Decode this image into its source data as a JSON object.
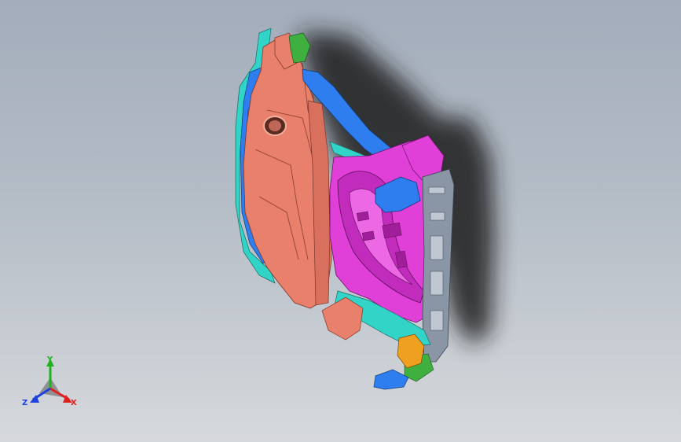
{
  "viewport": {
    "background_top": "#a3adbb",
    "background_bottom": "#d6d9dc"
  },
  "model": {
    "colors": {
      "salmon_panel": "#e8806b",
      "magenta_panel": "#e040d8",
      "blue_rail": "#2f7ef0",
      "cyan_trim": "#33d4c8",
      "green_bracket": "#3fb040",
      "gray_frame": "#8a96a6",
      "orange_bracket": "#f0a020",
      "shadow": "#1c1c1c"
    }
  },
  "triad": {
    "y_label": "Y",
    "x_label": "X",
    "z_label": "Z",
    "colors": {
      "x": "#e02020",
      "y": "#20b020",
      "z": "#2040e0"
    }
  }
}
